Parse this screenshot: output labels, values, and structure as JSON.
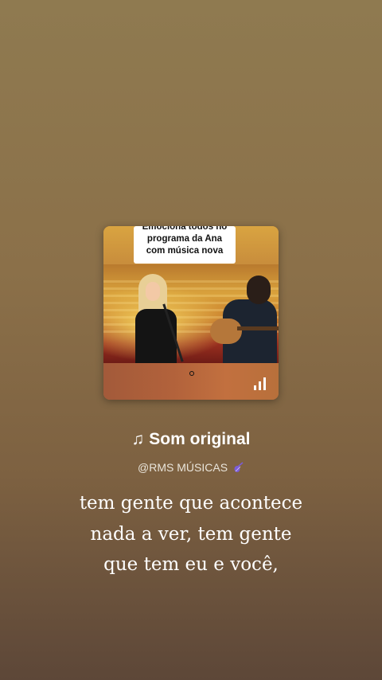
{
  "cover": {
    "caption_lines": [
      "Emociona todos no",
      "programa da Ana",
      "com música nova"
    ]
  },
  "sound": {
    "note_icon": "♫",
    "title": "Som original",
    "author": "@RMS MÚSICAS",
    "author_icon": "violin-icon"
  },
  "lyrics": {
    "lines": [
      "tem gente que acontece",
      "nada a ver, tem gente",
      "que tem eu e você,"
    ]
  },
  "colors": {
    "accent_violin": "#7b5cd6",
    "text": "#ffffff"
  },
  "icons": {
    "equalizer": "equalizer-icon"
  }
}
